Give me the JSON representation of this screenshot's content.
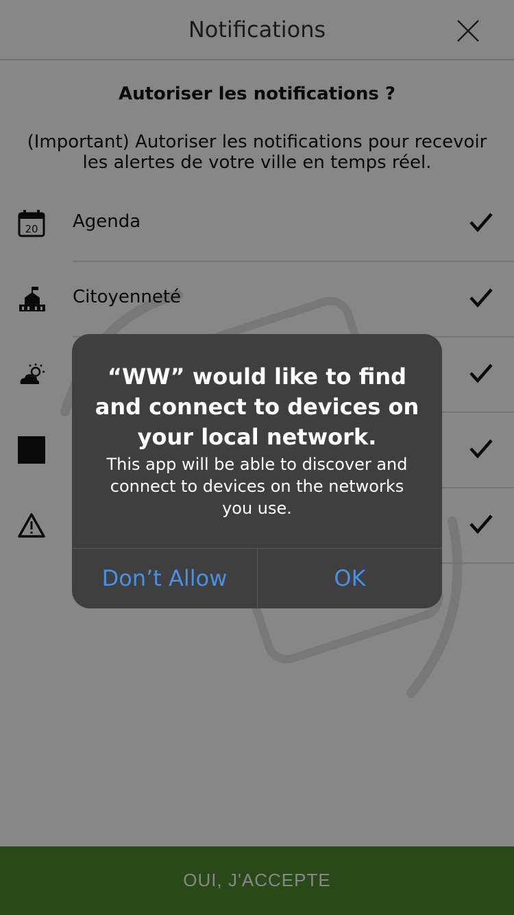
{
  "header": {
    "title": "Notifications"
  },
  "content": {
    "question": "Autoriser les notifications ?",
    "description": "(Important) Autoriser les notifications pour recevoir les alertes de votre ville en temps réel."
  },
  "items": [
    {
      "label": "Agenda",
      "icon": "calendar-icon",
      "calendar_day": "20",
      "checked": true
    },
    {
      "label": "Citoyenneté",
      "icon": "town-hall-icon",
      "checked": true
    },
    {
      "label": "",
      "icon": "weather-icon",
      "checked": true
    },
    {
      "label": "",
      "icon": "square-icon",
      "checked": true
    },
    {
      "label": "",
      "icon": "warning-icon",
      "checked": true
    }
  ],
  "footer": {
    "accept_label": "OUI, J'ACCEPTE"
  },
  "alert": {
    "title": "“WW” would like to find and connect to devices on your local network.",
    "message": "This app will be able to discover and connect to devices on the networks you use.",
    "deny_label": "Don’t Allow",
    "ok_label": "OK"
  },
  "colors": {
    "accent": "#4a90e2",
    "footer_bg": "#4f8a2e",
    "alert_bg": "#3f3f3f"
  }
}
